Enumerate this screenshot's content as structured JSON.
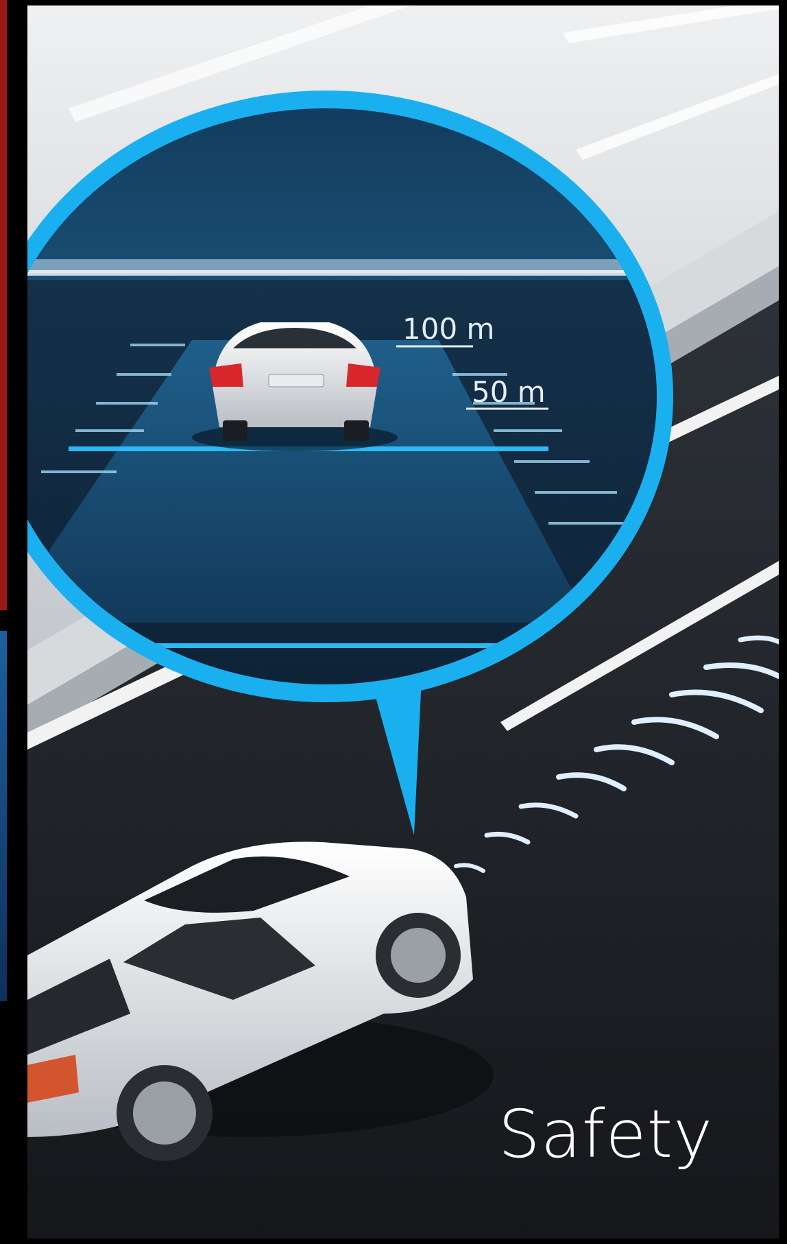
{
  "card": {
    "label": "Safety"
  },
  "inset": {
    "marker_far": "100 m",
    "marker_near": "50 m"
  },
  "colors": {
    "accent": "#1ab0f0",
    "road_dark": "#1c1f24",
    "left_edge_red": "#9a1a1a",
    "left_edge_blue": "#1c5fa0"
  }
}
